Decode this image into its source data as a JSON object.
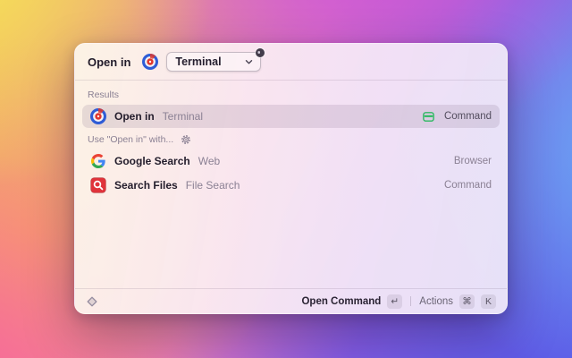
{
  "header": {
    "label": "Open in",
    "dropdown": {
      "value": "Terminal"
    }
  },
  "sections": {
    "results": "Results",
    "use_with": "Use \"Open in\" with..."
  },
  "rows": [
    {
      "icon": "open-in-extension-icon",
      "title": "Open in",
      "subtitle": "Terminal",
      "accessory_icon": "app-window-icon",
      "accessory": "Command",
      "selected": true
    },
    {
      "icon": "google-icon",
      "title": "Google Search",
      "subtitle": "Web",
      "accessory": "Browser",
      "selected": false
    },
    {
      "icon": "file-search-icon",
      "title": "Search Files",
      "subtitle": "File Search",
      "accessory": "Command",
      "selected": false
    }
  ],
  "footer": {
    "primary_label": "Open Command",
    "primary_key": "↵",
    "actions_label": "Actions",
    "action_keys": [
      "⌘",
      "K"
    ]
  },
  "colors": {
    "accent_green": "#2db961",
    "file_search_red": "#e0333b",
    "open_in_blue": "#2e5cd6",
    "open_in_red": "#e0362c",
    "google_red": "#EA4335",
    "google_blue": "#4285F4",
    "google_yellow": "#FBBC05",
    "google_green": "#34A853"
  }
}
